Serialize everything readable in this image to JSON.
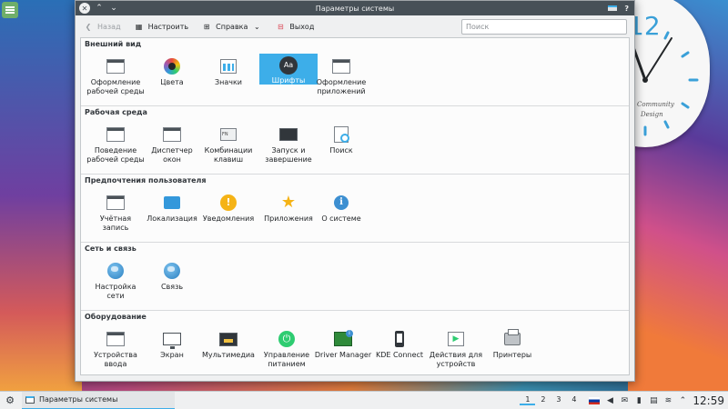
{
  "window": {
    "title": "Параметры системы"
  },
  "toolbar": {
    "back_label": "Назад",
    "configure_label": "Настроить",
    "help_label": "Справка",
    "quit_label": "Выход",
    "search_placeholder": "Поиск"
  },
  "sections": [
    {
      "title": "Внешний вид",
      "items": [
        {
          "label": "Оформление рабочей среды",
          "icon": "workspace-theme-icon"
        },
        {
          "label": "Цвета",
          "icon": "colors-icon"
        },
        {
          "label": "Значки",
          "icon": "icons-icon"
        },
        {
          "label": "Шрифты",
          "icon": "fonts-icon",
          "selected": true
        },
        {
          "label": "Оформление приложений",
          "icon": "application-style-icon"
        }
      ]
    },
    {
      "title": "Рабочая среда",
      "items": [
        {
          "label": "Поведение рабочей среды",
          "icon": "desktop-behavior-icon"
        },
        {
          "label": "Диспетчер окон",
          "icon": "window-manager-icon"
        },
        {
          "label": "Комбинации клавиш",
          "icon": "shortcuts-icon"
        },
        {
          "label": "Запуск и завершение",
          "icon": "startup-shutdown-icon"
        },
        {
          "label": "Поиск",
          "icon": "search-icon"
        }
      ]
    },
    {
      "title": "Предпочтения пользователя",
      "items": [
        {
          "label": "Учётная запись",
          "icon": "account-icon"
        },
        {
          "label": "Локализация",
          "icon": "localization-icon"
        },
        {
          "label": "Уведомления",
          "icon": "notifications-icon"
        },
        {
          "label": "Приложения",
          "icon": "applications-icon"
        },
        {
          "label": "О системе",
          "icon": "about-system-icon"
        }
      ]
    },
    {
      "title": "Сеть и связь",
      "items": [
        {
          "label": "Настройка сети",
          "icon": "network-settings-icon"
        },
        {
          "label": "Связь",
          "icon": "connectivity-icon"
        }
      ]
    },
    {
      "title": "Оборудование",
      "items": [
        {
          "label": "Устройства ввода",
          "icon": "input-devices-icon"
        },
        {
          "label": "Экран",
          "icon": "display-icon"
        },
        {
          "label": "Мультимедиа",
          "icon": "multimedia-icon"
        },
        {
          "label": "Управление питанием",
          "icon": "power-management-icon"
        },
        {
          "label": "Driver Manager",
          "icon": "driver-manager-icon"
        },
        {
          "label": "KDE Connect",
          "icon": "kde-connect-icon"
        },
        {
          "label": "Действия для устройств",
          "icon": "device-actions-icon"
        },
        {
          "label": "Принтеры",
          "icon": "printers-icon"
        }
      ]
    }
  ],
  "clock_widget": {
    "numeral": "12",
    "brand_line1": "Community",
    "brand_line2": "Design"
  },
  "taskbar": {
    "task_label": "Параметры системы",
    "desktops": [
      "1",
      "2",
      "3",
      "4"
    ],
    "active_desktop": "1",
    "time": "12:59"
  },
  "colors": {
    "accent": "#3daee9",
    "titlebar": "#475057",
    "window_bg": "#eff0f1"
  }
}
